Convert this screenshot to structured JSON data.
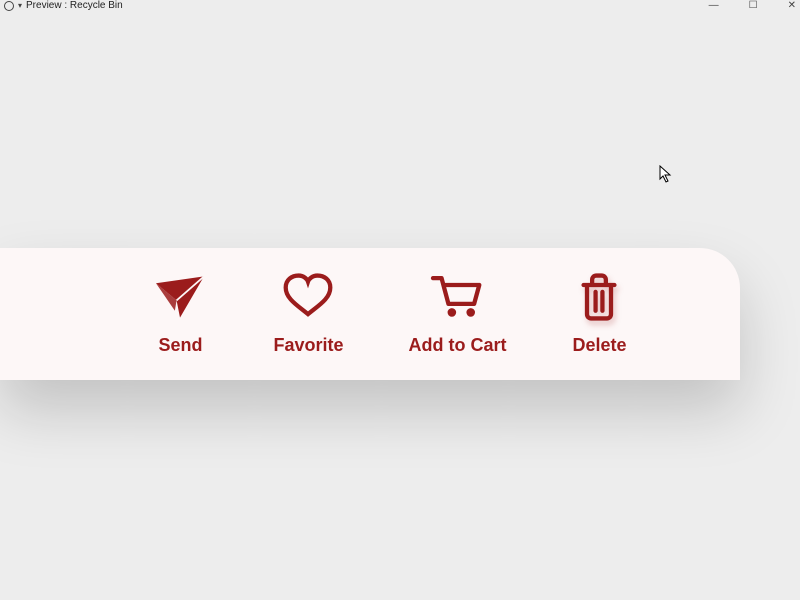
{
  "window": {
    "title": "Preview : Recycle Bin"
  },
  "actions": {
    "send": {
      "label": "Send"
    },
    "favorite": {
      "label": "Favorite"
    },
    "cart": {
      "label": "Add to Cart"
    },
    "delete": {
      "label": "Delete"
    }
  },
  "colors": {
    "accent": "#9b1c1c",
    "panel": "#fdf7f7",
    "bg": "#ededed"
  }
}
